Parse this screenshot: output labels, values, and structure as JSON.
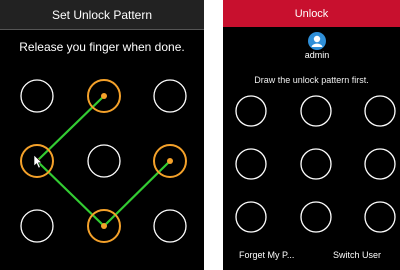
{
  "left": {
    "title": "Set Unlock Pattern",
    "message": "Release you finger when done.",
    "selected_color": "#f4a12a",
    "line_color": "#33cc33"
  },
  "right": {
    "title": "Unlock",
    "username": "admin",
    "message": "Draw the unlock pattern first.",
    "forgot_label": "Forget My P...",
    "switch_user_label": "Switch User",
    "accent_color": "#c8102e"
  }
}
